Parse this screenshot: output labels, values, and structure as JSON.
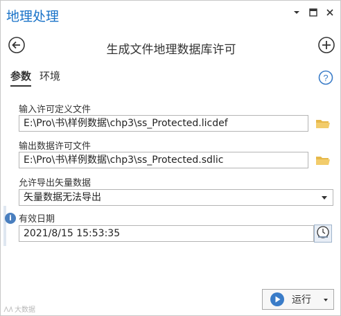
{
  "pane": {
    "title": "地理处理"
  },
  "tool": {
    "title": "生成文件地理数据库许可"
  },
  "tabs": [
    {
      "label": "参数",
      "active": true
    },
    {
      "label": "环境",
      "active": false
    }
  ],
  "params": {
    "license_def": {
      "label": "输入许可定义文件",
      "value": "E:\\Pro\\书\\样例数据\\chp3\\ss_Protected.licdef"
    },
    "output_license": {
      "label": "输出数据许可文件",
      "value": "E:\\Pro\\书\\样例数据\\chp3\\ss_Protected.sdlic"
    },
    "allow_export": {
      "label": "允许导出矢量数据",
      "selected": "矢量数据无法导出"
    },
    "expiry": {
      "label": "有效日期",
      "value": "2021/8/15 15:53:35"
    }
  },
  "footer": {
    "run_label": "运行",
    "watermark": "大数据"
  },
  "colors": {
    "accent": "#1a73c8",
    "folder": "#e6b84a",
    "info": "#4a7fbf"
  },
  "icons": [
    "chevron-down-icon",
    "maximize-icon",
    "close-icon",
    "back-icon",
    "add-icon",
    "help-icon",
    "folder-icon",
    "info-icon",
    "clock-icon",
    "play-icon"
  ]
}
